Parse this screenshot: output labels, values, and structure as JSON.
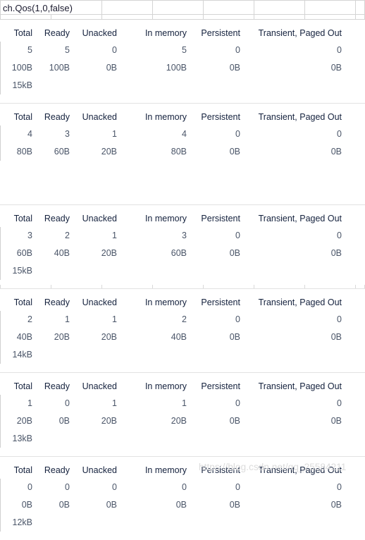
{
  "formula_bar": {
    "value": "ch.Qos(1,0,false)",
    "grid_column_edges": [
      0,
      144,
      216,
      288,
      360,
      432,
      504,
      517
    ],
    "sub_row_column_edges": [
      0,
      72,
      144,
      216,
      288,
      360,
      432,
      504,
      517
    ]
  },
  "columns": [
    "Total",
    "Ready",
    "Unacked",
    "In memory",
    "Persistent",
    "Transient, Paged Out"
  ],
  "blocks": [
    {
      "counts": [
        "5",
        "5",
        "0",
        "5",
        "0",
        "0"
      ],
      "bytes": [
        "100B",
        "100B",
        "0B",
        "100B",
        "0B",
        "0B"
      ],
      "total_memory": "15kB",
      "has_ticks": false
    },
    {
      "counts": [
        "4",
        "3",
        "1",
        "4",
        "0",
        "0"
      ],
      "bytes": [
        "80B",
        "60B",
        "20B",
        "80B",
        "0B",
        "0B"
      ],
      "total_memory": "",
      "has_ticks": false
    },
    {
      "counts": [
        "3",
        "2",
        "1",
        "3",
        "0",
        "0"
      ],
      "bytes": [
        "60B",
        "40B",
        "20B",
        "60B",
        "0B",
        "0B"
      ],
      "total_memory": "15kB",
      "has_ticks": true
    },
    {
      "counts": [
        "2",
        "1",
        "1",
        "2",
        "0",
        "0"
      ],
      "bytes": [
        "40B",
        "20B",
        "20B",
        "40B",
        "0B",
        "0B"
      ],
      "total_memory": "14kB",
      "has_ticks": false
    },
    {
      "counts": [
        "1",
        "0",
        "1",
        "1",
        "0",
        "0"
      ],
      "bytes": [
        "20B",
        "0B",
        "20B",
        "20B",
        "0B",
        "0B"
      ],
      "total_memory": "13kB",
      "has_ticks": false
    },
    {
      "counts": [
        "0",
        "0",
        "0",
        "0",
        "0",
        "0"
      ],
      "bytes": [
        "0B",
        "0B",
        "0B",
        "0B",
        "0B",
        "0B"
      ],
      "total_memory": "12kB",
      "has_ticks": false
    }
  ],
  "watermark": {
    "text": "https://blog.csdn.net/qq_25584211"
  },
  "colors": {
    "grid_line": "#d4d4d4",
    "block_divider": "#e2e2e2",
    "header_text": "#14213d",
    "value_text": "#4a5568",
    "watermark_text": "#dcdcdc",
    "background": "#ffffff"
  }
}
